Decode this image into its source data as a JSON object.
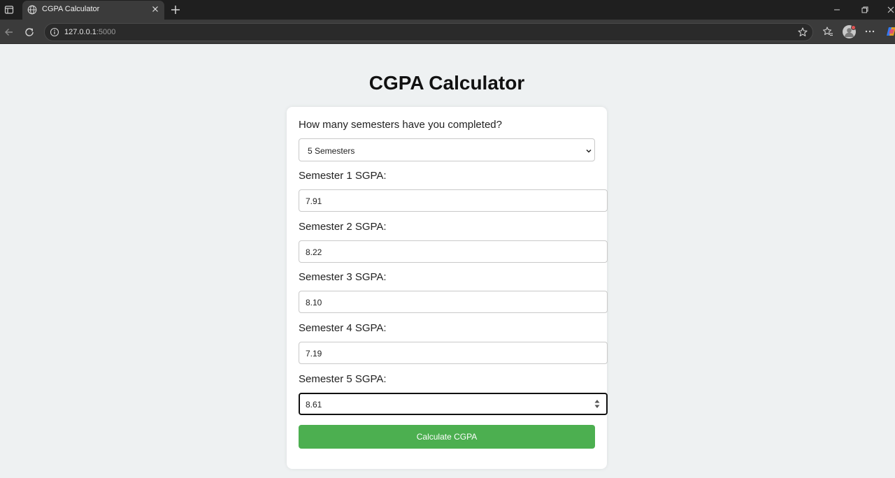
{
  "browser": {
    "tab_title": "CGPA Calculator",
    "url_host": "127.0.0.1",
    "url_port": ":5000"
  },
  "page": {
    "title": "CGPA Calculator",
    "semester_question": "How many semesters have you completed?",
    "semester_select_value": "5 Semesters",
    "semesters": [
      {
        "label": "Semester 1 SGPA:",
        "value": "7.91"
      },
      {
        "label": "Semester 2 SGPA:",
        "value": "8.22"
      },
      {
        "label": "Semester 3 SGPA:",
        "value": "8.10"
      },
      {
        "label": "Semester 4 SGPA:",
        "value": "7.19"
      },
      {
        "label": "Semester 5 SGPA:",
        "value": "8.61"
      }
    ],
    "calculate_label": "Calculate CGPA"
  },
  "colors": {
    "button_green": "#4caf50",
    "page_bg": "#eef1f2",
    "chrome_dark": "#1f1f1f"
  },
  "icons": [
    "sidebar-icon",
    "globe-icon",
    "close-icon",
    "plus-icon",
    "minimize-icon",
    "restore-icon",
    "back-icon",
    "reload-icon",
    "info-icon",
    "star-icon",
    "favorites-icon",
    "profile-icon",
    "more-icon",
    "copilot-icon",
    "chevron-down-icon",
    "spinner-icon"
  ]
}
